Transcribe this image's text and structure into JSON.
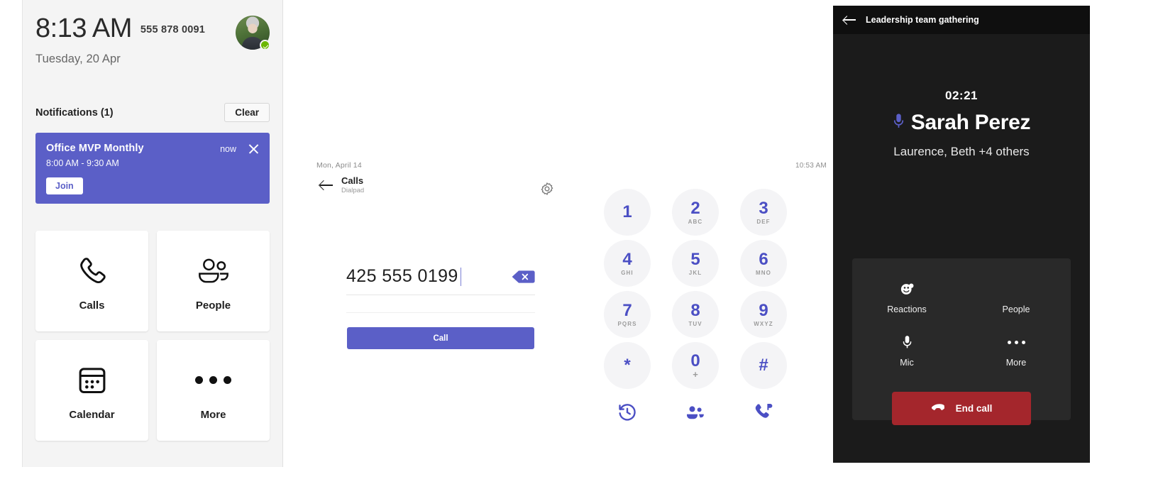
{
  "home": {
    "time": "8:13 AM",
    "phone_number": "555 878 0091",
    "date": "Tuesday, 20 Apr",
    "avatar_name": "avatar",
    "presence_status": "available",
    "notifications": {
      "title": "Notifications (1)",
      "clear_label": "Clear",
      "card": {
        "name": "Office MVP Monthly",
        "when": "now",
        "time_range": "8:00 AM - 9:30 AM",
        "join_label": "Join",
        "bg_color": "#5b5fc7"
      }
    },
    "tiles": [
      {
        "label": "Calls",
        "icon": "phone-icon"
      },
      {
        "label": "People",
        "icon": "people-icon"
      },
      {
        "label": "Calendar",
        "icon": "calendar-icon"
      },
      {
        "label": "More",
        "icon": "more-dots-icon"
      }
    ]
  },
  "dialpad": {
    "date_label": "Mon, April 14",
    "title": "Calls",
    "subtitle": "Dialpad",
    "clock": "10:53 AM",
    "settings_icon": "gear-icon",
    "back_icon": "back-arrow-icon",
    "number_value": "425 555 0199",
    "backspace_icon": "backspace-icon",
    "call_label": "Call",
    "accent_color": "#5b5fc7",
    "keys": [
      {
        "digit": "1",
        "sub": ""
      },
      {
        "digit": "2",
        "sub": "ABC"
      },
      {
        "digit": "3",
        "sub": "DEF"
      },
      {
        "digit": "4",
        "sub": "GHI"
      },
      {
        "digit": "5",
        "sub": "JKL"
      },
      {
        "digit": "6",
        "sub": "MNO"
      },
      {
        "digit": "7",
        "sub": "PQRS"
      },
      {
        "digit": "8",
        "sub": "TUV"
      },
      {
        "digit": "9",
        "sub": "WXYZ"
      },
      {
        "digit": "*",
        "sub": ""
      },
      {
        "digit": "0",
        "sub": "+"
      },
      {
        "digit": "#",
        "sub": ""
      }
    ],
    "actions": [
      {
        "icon": "history-icon"
      },
      {
        "icon": "contacts-icon"
      },
      {
        "icon": "parked-call-icon"
      }
    ]
  },
  "call": {
    "header_title": "Leadership team gathering",
    "back_icon": "back-arrow-icon",
    "timer": "02:21",
    "active_speaker": "Sarah Perez",
    "speaker_mic_icon": "mic-icon",
    "participants": "Laurence, Beth +4 others",
    "controls": [
      {
        "label": "Reactions",
        "icon": "reactions-icon"
      },
      {
        "label": "People",
        "icon": "people-icon"
      },
      {
        "label": "Mic",
        "icon": "mic-icon"
      },
      {
        "label": "More",
        "icon": "more-dots-icon"
      }
    ],
    "end_call_label": "End call",
    "end_call_color": "#a4262c",
    "end_call_icon": "hangup-icon"
  }
}
